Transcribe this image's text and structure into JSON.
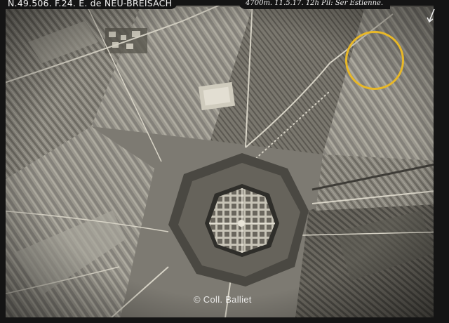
{
  "photo": {
    "description_kind": "aerial reconnaissance photograph",
    "caption_left": "N.49.506. F.24. E. de NEU-BREISACH",
    "caption_right": "4700m. 11.5.17. 12h  Pil: Ser Estienne.",
    "watermark": "© Coll. Balliet",
    "highlight_color": "#e8b827",
    "corner_mark": "arrow-mark"
  }
}
